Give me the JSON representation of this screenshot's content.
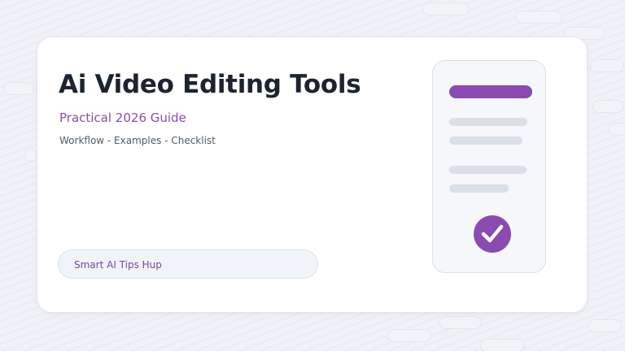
{
  "title": "Ai Video Editing Tools",
  "subtitle": "Practical 2026 Guide",
  "tagline": "Workflow - Examples - Checklist",
  "brand": "Smart AI Tips Hup",
  "colors": {
    "accent": "#8b4ab0",
    "title": "#1c2430",
    "subtitle": "#8a4ca8",
    "background": "#eff1f6",
    "card": "#ffffff"
  },
  "icons": {
    "checkmark": "check-circle-icon"
  }
}
